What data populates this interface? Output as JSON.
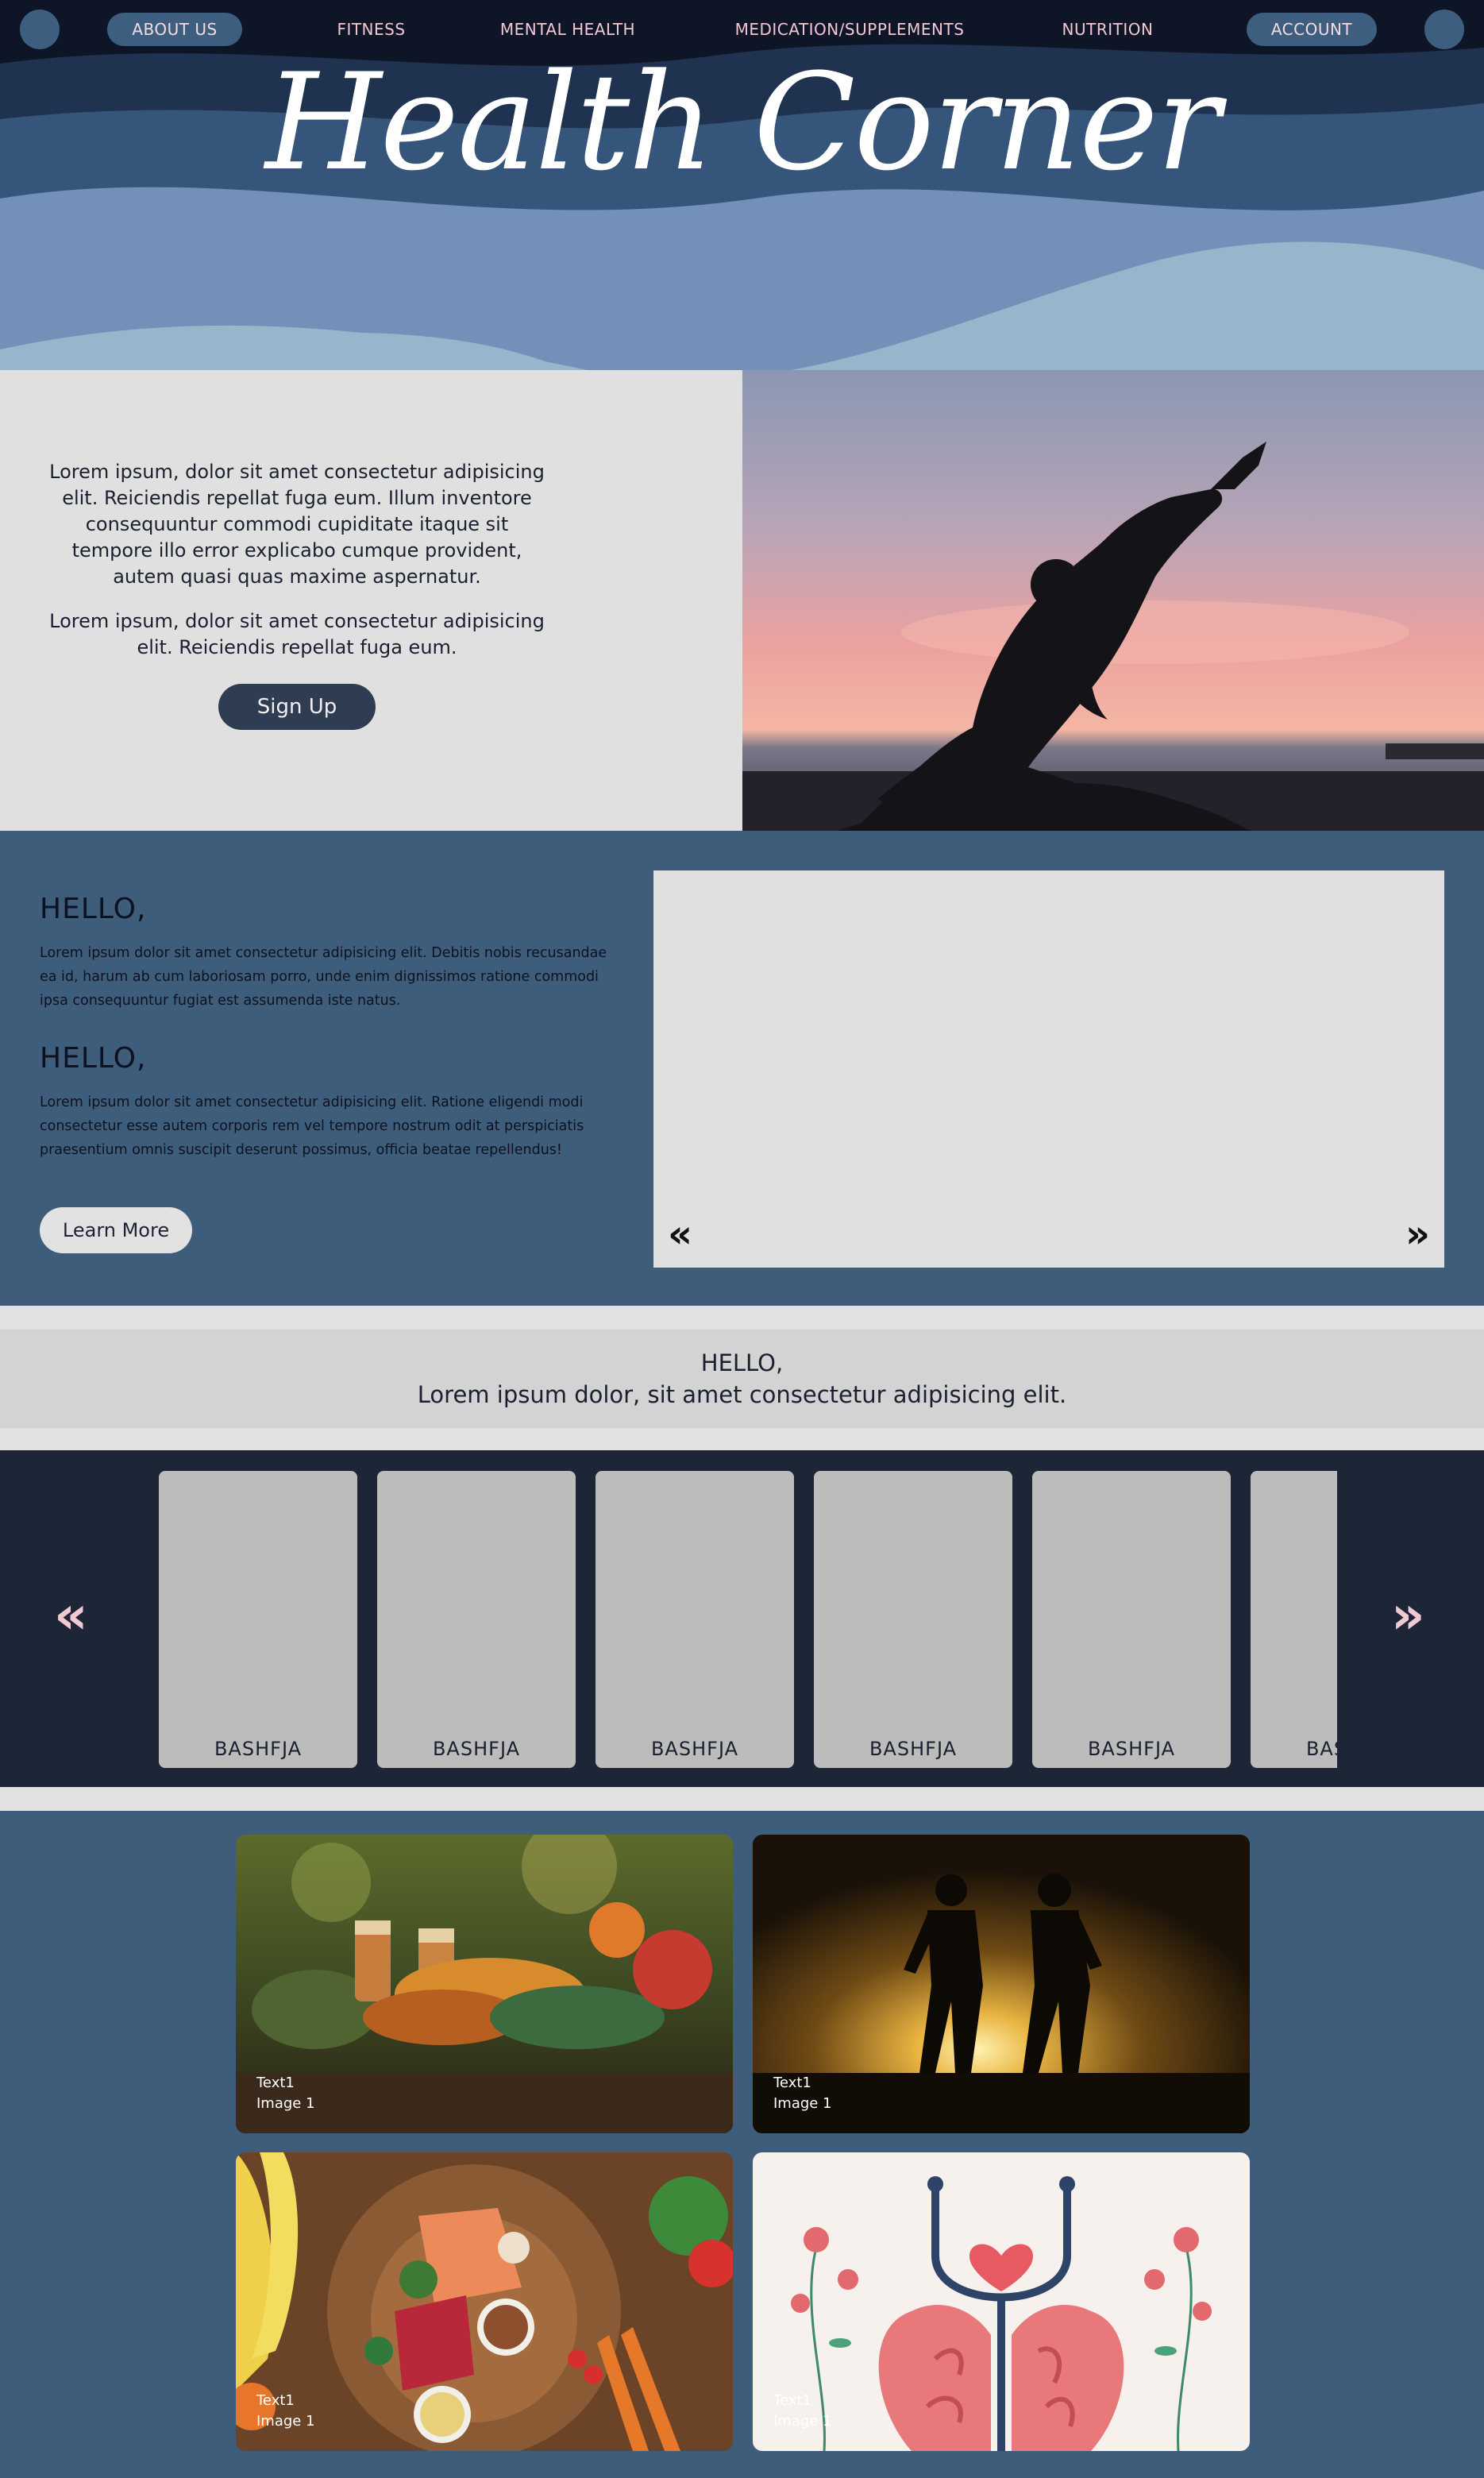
{
  "nav": {
    "items": [
      {
        "label": "ABOUT US"
      },
      {
        "label": "FITNESS"
      },
      {
        "label": "MENTAL HEALTH"
      },
      {
        "label": "MEDICATION/SUPPLEMENTS"
      },
      {
        "label": "NUTRITION"
      },
      {
        "label": "ACCOUNT"
      }
    ]
  },
  "brand": {
    "title": "Health Corner"
  },
  "intro": {
    "paragraph_1": "Lorem ipsum, dolor sit amet consectetur adipisicing elit. Reiciendis repellat fuga eum. Illum inventore consequuntur commodi cupiditate itaque sit tempore illo error explicabo cumque provident, autem quasi quas maxime aspernatur.",
    "paragraph_2": "Lorem ipsum, dolor sit amet consectetur adipisicing elit. Reiciendis repellat fuga eum.",
    "signup_label": "Sign Up",
    "image_icon": "yoga-silhouette-sunset"
  },
  "hello": {
    "heading_1": "HELLO,",
    "text_1": "Lorem ipsum dolor sit amet consectetur adipisicing elit. Debitis nobis recusandae ea id, harum ab cum laboriosam porro, unde enim dignissimos ratione commodi ipsa consequuntur fugiat est assumenda iste natus.",
    "heading_2": "HELLO,",
    "text_2": "Lorem ipsum dolor sit amet consectetur adipisicing elit. Ratione eligendi modi consectetur esse autem corporis rem vel tempore nostrum odit at perspiciatis praesentium omnis suscipit deserunt possimus, officia beatae repellendus!",
    "learn_more_label": "Learn More",
    "prev_arrow": "«",
    "next_arrow": "»"
  },
  "banner": {
    "line_1": "HELLO,",
    "line_2": "Lorem ipsum dolor, sit amet consectetur adipisicing elit."
  },
  "carousel": {
    "prev_arrow": "«",
    "next_arrow": "»",
    "cards": [
      {
        "label": "BASHFJA"
      },
      {
        "label": "BASHFJA"
      },
      {
        "label": "BASHFJA"
      },
      {
        "label": "BASHFJA"
      },
      {
        "label": "BASHFJA"
      },
      {
        "label": "BASHFJA"
      }
    ]
  },
  "gallery": {
    "tiles": [
      {
        "text": "Text1",
        "sub": "Image 1",
        "icon": "supplements-photo"
      },
      {
        "text": "Text1",
        "sub": "Image 1",
        "icon": "runners-silhouette-photo"
      },
      {
        "text": "Text1",
        "sub": "Image 1",
        "icon": "balanced-diet-photo"
      },
      {
        "text": "Text1",
        "sub": "Image 1",
        "icon": "brain-stethoscope-illustration"
      }
    ]
  },
  "colors": {
    "navy": "#0e1526",
    "slate": "#3e5d7b",
    "pink_accent": "#f1c7d2",
    "light_gray": "#e0e0e0"
  }
}
